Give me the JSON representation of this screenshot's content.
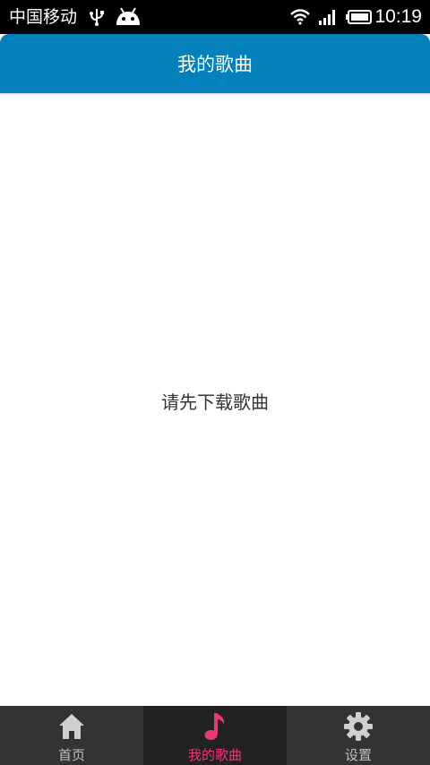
{
  "status_bar": {
    "carrier": "中国移动",
    "time": "10:19",
    "icons": [
      "usb-icon",
      "android-icon",
      "wifi-icon",
      "signal-icon",
      "battery-icon"
    ]
  },
  "header": {
    "title": "我的歌曲",
    "color": "#0480bb"
  },
  "main": {
    "empty_message": "请先下载歌曲"
  },
  "bottom_nav": {
    "active_color": "#e8387a",
    "tabs": [
      {
        "label": "首页",
        "icon": "home-icon",
        "active": false
      },
      {
        "label": "我的歌曲",
        "icon": "music-note-icon",
        "active": true
      },
      {
        "label": "设置",
        "icon": "gear-icon",
        "active": false
      }
    ]
  }
}
